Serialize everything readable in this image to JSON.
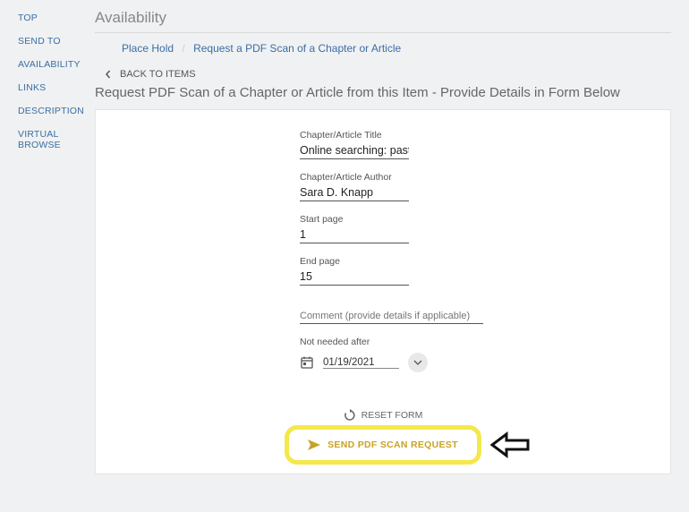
{
  "sidebar": {
    "items": [
      {
        "label": "TOP"
      },
      {
        "label": "SEND TO"
      },
      {
        "label": "AVAILABILITY"
      },
      {
        "label": "LINKS"
      },
      {
        "label": "DESCRIPTION"
      },
      {
        "label": "VIRTUAL BROWSE"
      }
    ]
  },
  "section_title": "Availability",
  "tabs": {
    "place_hold": "Place Hold",
    "request_scan": "Request a PDF Scan of a Chapter or Article"
  },
  "back_label": "BACK TO ITEMS",
  "page_heading": "Request PDF Scan of a Chapter or Article from this Item - Provide Details in Form Below",
  "form": {
    "title": {
      "label": "Chapter/Article Title",
      "value": "Online searching: past, pres"
    },
    "author": {
      "label": "Chapter/Article Author",
      "value": "Sara D. Knapp"
    },
    "start_page": {
      "label": "Start page",
      "value": "1"
    },
    "end_page": {
      "label": "End page",
      "value": "15"
    },
    "comment": {
      "placeholder": "Comment (provide details if applicable)"
    },
    "not_needed": {
      "label": "Not needed after",
      "value": "01/19/2021"
    }
  },
  "actions": {
    "reset": "RESET FORM",
    "send": "SEND PDF SCAN REQUEST"
  }
}
